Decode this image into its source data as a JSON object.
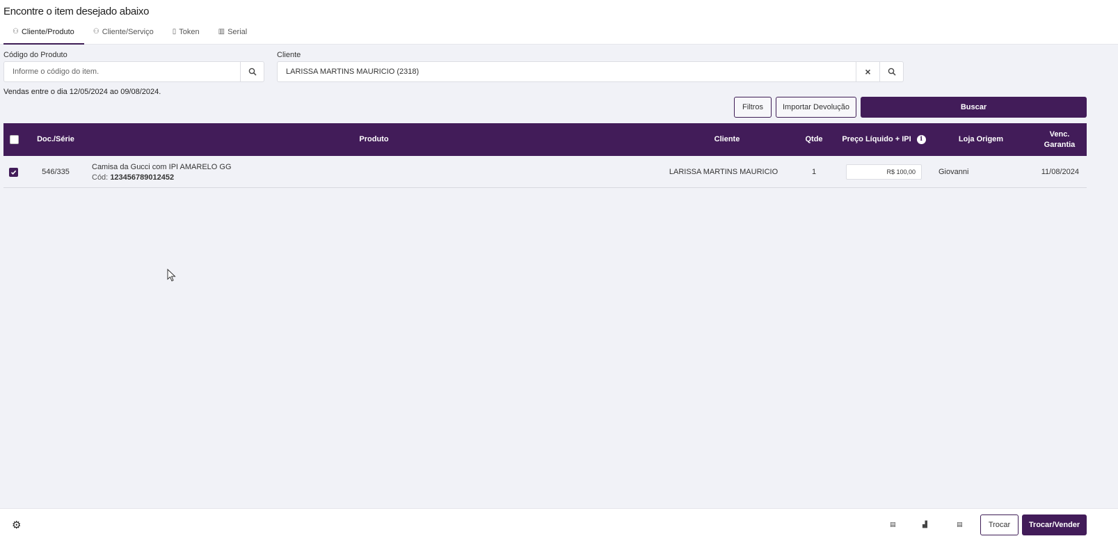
{
  "header": {
    "title": "Encontre o item desejado abaixo",
    "tabs": [
      {
        "label": "Cliente/Produto",
        "icon": "user-store-icon",
        "active": true
      },
      {
        "label": "Cliente/Serviço",
        "icon": "user-store-icon",
        "active": false
      },
      {
        "label": "Token",
        "icon": "receipt-icon",
        "active": false
      },
      {
        "label": "Serial",
        "icon": "barcode-icon",
        "active": false
      }
    ]
  },
  "filters": {
    "product_code_label": "Código do Produto",
    "product_code_placeholder": "Informe o código do item.",
    "product_code_value": "",
    "client_label": "Cliente",
    "client_value": "LARISSA MARTINS MAURICIO (2318)"
  },
  "sales_period_note": "Vendas entre o dia 12/05/2024 ao 09/08/2024.",
  "actions": {
    "filters_label": "Filtros",
    "import_return_label": "Importar Devolução",
    "search_label": "Buscar"
  },
  "table": {
    "columns": [
      "Doc./Série",
      "Produto",
      "Cliente",
      "Qtde",
      "Preço Líquido + IPI",
      "Loja Origem",
      "Venc. Garantia"
    ],
    "rows": [
      {
        "checked": true,
        "doc_serie": "546/335",
        "product_name": "Camisa da Gucci com IPI AMARELO GG",
        "product_code_prefix": "Cód:",
        "product_code": "123456789012452",
        "client": "LARISSA MARTINS MAURICIO",
        "qty": "1",
        "price": "R$ 100,00",
        "origin_store": "Giovanni",
        "warranty_due": "11/08/2024"
      }
    ]
  },
  "footer": {
    "trocar_label": "Trocar",
    "trocar_vender_label": "Trocar/Vender"
  },
  "colors": {
    "primary": "#421c59",
    "background": "#f1f2f7"
  }
}
